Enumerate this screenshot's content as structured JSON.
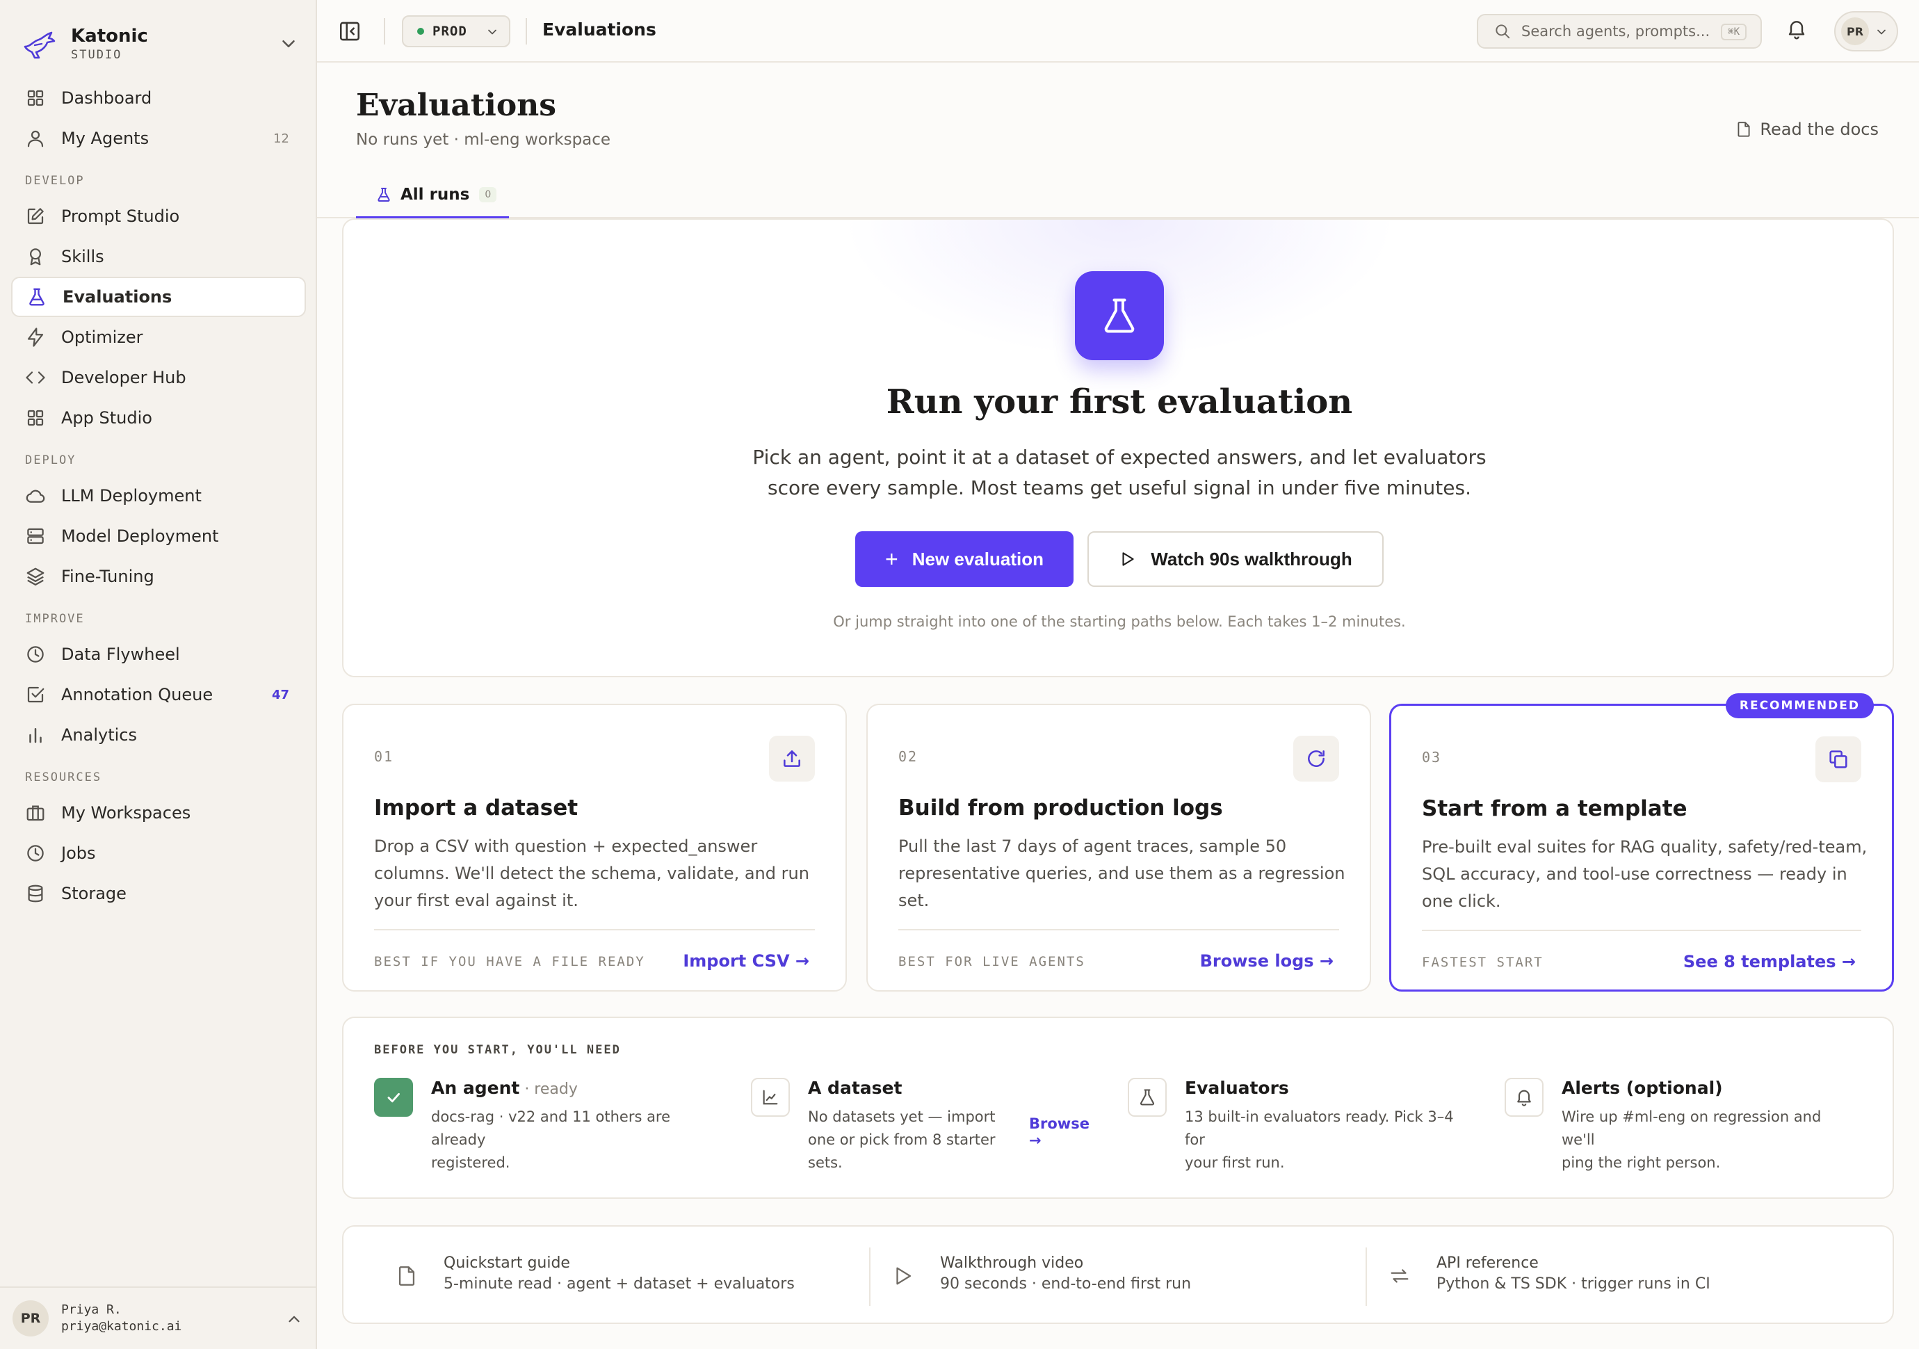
{
  "brand": {
    "name": "Katonic",
    "subtitle": "STUDIO"
  },
  "nav": {
    "dashboard": "Dashboard",
    "my_agents": "My Agents",
    "my_agents_count": "12",
    "section_develop": "DEVELOP",
    "prompt_studio": "Prompt Studio",
    "skills": "Skills",
    "evaluations": "Evaluations",
    "optimizer": "Optimizer",
    "developer_hub": "Developer Hub",
    "app_studio": "App Studio",
    "section_deploy": "DEPLOY",
    "llm_deployment": "LLM Deployment",
    "model_deployment": "Model Deployment",
    "fine_tuning": "Fine-Tuning",
    "section_improve": "IMPROVE",
    "data_flywheel": "Data Flywheel",
    "annotation_queue": "Annotation Queue",
    "annotation_count": "47",
    "analytics": "Analytics",
    "section_resources": "RESOURCES",
    "my_workspaces": "My Workspaces",
    "jobs": "Jobs",
    "storage": "Storage"
  },
  "user": {
    "initials": "PR",
    "name": "Priya R.",
    "email": "priya@katonic.ai"
  },
  "topbar": {
    "env": "PROD",
    "title": "Evaluations",
    "search_placeholder": "Search agents, prompts...",
    "search_shortcut": "⌘K",
    "user_initials": "PR"
  },
  "header": {
    "title": "Evaluations",
    "subtitle": "No runs yet · ml-eng workspace",
    "docs_link": "Read the docs"
  },
  "tabs": [
    {
      "label": "All runs",
      "count": "0"
    }
  ],
  "hero": {
    "title": "Run your first evaluation",
    "description": "Pick an agent, point it at a dataset of expected answers, and let evaluators score every sample. Most teams get useful signal in under five minutes.",
    "primary_label": "New evaluation",
    "secondary_label": "Watch 90s walkthrough",
    "hint": "Or jump straight into one of the starting paths below. Each takes 1–2 minutes."
  },
  "paths": [
    {
      "num": "01",
      "title": "Import a dataset",
      "desc": "Drop a CSV with question + expected_answer columns. We'll detect the schema, validate, and run your first eval against it.",
      "foot": "BEST IF YOU HAVE A FILE READY",
      "link": "Import CSV →",
      "icon": "upload-icon"
    },
    {
      "num": "02",
      "title": "Build from production logs",
      "desc": "Pull the last 7 days of agent traces, sample 50 representative queries, and use them as a regression set.",
      "foot": "BEST FOR LIVE AGENTS",
      "link": "Browse logs →",
      "icon": "refresh-icon"
    },
    {
      "num": "03",
      "title": "Start from a template",
      "desc": "Pre-built eval suites for RAG quality, safety/red-team, SQL accuracy, and tool-use correctness — ready in one click.",
      "foot": "FASTEST START",
      "link": "See 8 templates →",
      "icon": "copy-icon",
      "badge": "RECOMMENDED"
    }
  ],
  "prereqs": {
    "heading": "BEFORE YOU START, YOU'LL NEED",
    "items": [
      {
        "title": "An agent",
        "status": " · ready",
        "desc1": "docs-rag · v22 and 11 others are already",
        "desc2": "registered.",
        "icon": "check-icon"
      },
      {
        "title": "A dataset",
        "desc1": "No datasets yet — import",
        "desc2": "one or pick from 8 starter",
        "desc3": "sets.",
        "link": "Browse →",
        "icon": "chart-icon"
      },
      {
        "title": "Evaluators",
        "desc1": "13 built-in evaluators ready. Pick 3–4 for",
        "desc2": "your first run.",
        "icon": "flask-icon"
      },
      {
        "title": "Alerts (optional)",
        "desc1": "Wire up #ml-eng on regression and we'll",
        "desc2": "ping the right person.",
        "icon": "bell-icon"
      }
    ]
  },
  "resources": [
    {
      "title": "Quickstart guide",
      "desc": "5-minute read · agent + dataset + evaluators",
      "icon": "document-icon"
    },
    {
      "title": "Walkthrough video",
      "desc": "90 seconds · end-to-end first run",
      "icon": "play-icon"
    },
    {
      "title": "API reference",
      "desc": "Python & TS SDK · trigger runs in CI",
      "icon": "repeat-icon"
    }
  ],
  "colors": {
    "accent": "#5b3ff2",
    "success": "#4f9a6c",
    "env_dot": "#2f9e5a"
  }
}
